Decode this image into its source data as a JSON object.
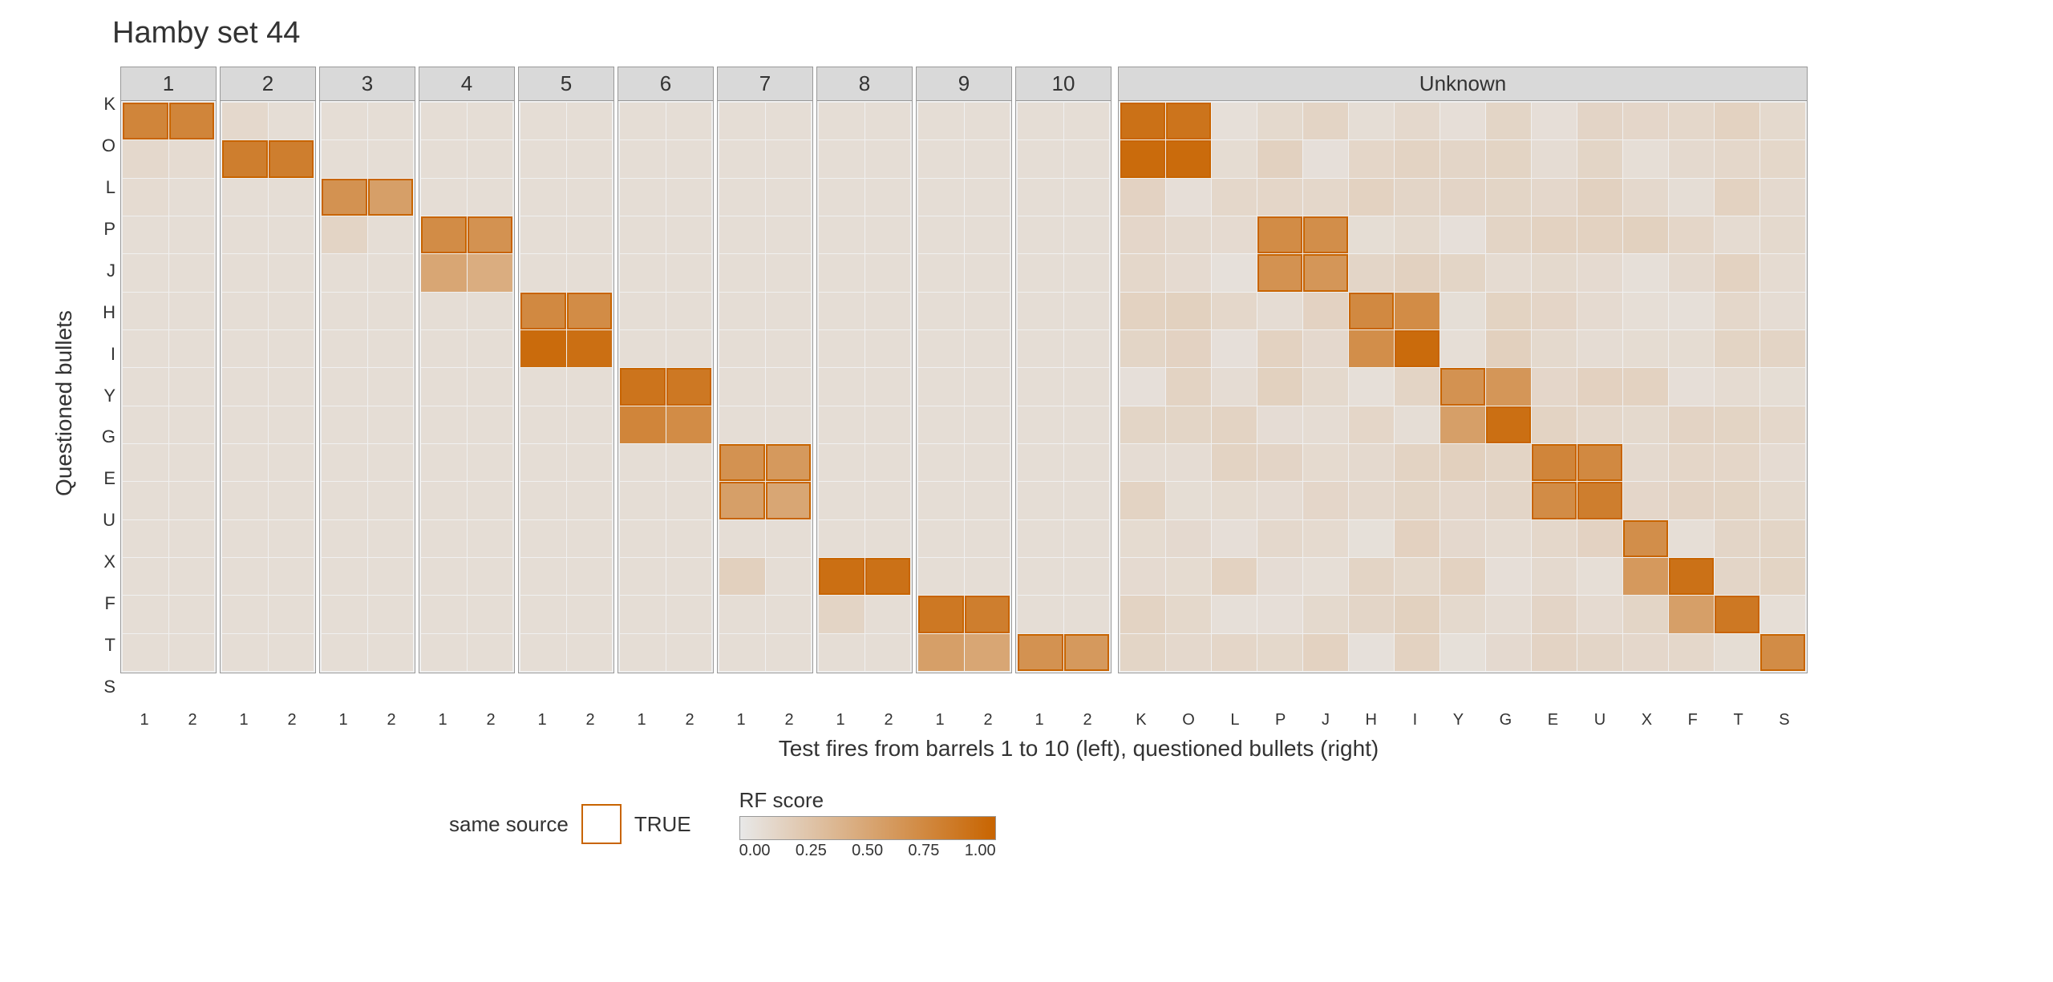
{
  "title": "Hamby set 44",
  "yAxisLabel": "Questioned bullets",
  "xAxisLabel": "Test fires from barrels 1 to 10 (left), questioned bullets (right)",
  "yLabels": [
    "K",
    "O",
    "L",
    "P",
    "J",
    "H",
    "I",
    "Y",
    "G",
    "E",
    "U",
    "X",
    "F",
    "T",
    "S"
  ],
  "barrelPanels": [
    {
      "id": "1",
      "cols": 2,
      "xTicks": [
        "1",
        "2"
      ]
    },
    {
      "id": "2",
      "cols": 2,
      "xTicks": [
        "1",
        "2"
      ]
    },
    {
      "id": "3",
      "cols": 2,
      "xTicks": [
        "1",
        "2"
      ]
    },
    {
      "id": "4",
      "cols": 2,
      "xTicks": [
        "1",
        "2"
      ]
    },
    {
      "id": "5",
      "cols": 2,
      "xTicks": [
        "1",
        "2"
      ]
    },
    {
      "id": "6",
      "cols": 2,
      "xTicks": [
        "1",
        "2"
      ]
    },
    {
      "id": "7",
      "cols": 2,
      "xTicks": [
        "1",
        "2"
      ]
    },
    {
      "id": "8",
      "cols": 2,
      "xTicks": [
        "1",
        "2"
      ]
    },
    {
      "id": "9",
      "cols": 2,
      "xTicks": [
        "1",
        "2"
      ]
    },
    {
      "id": "10",
      "cols": 2,
      "xTicks": [
        "1",
        "2"
      ]
    }
  ],
  "unknownPanel": {
    "id": "Unknown",
    "xTicks": [
      "K",
      "O",
      "L",
      "P",
      "J",
      "H",
      "I",
      "Y",
      "G",
      "E",
      "U",
      "X",
      "F",
      "T",
      "S"
    ]
  },
  "legend": {
    "sameSourceLabel": "same source",
    "trueLabel": "TRUE",
    "rfScoreLabel": "RF score",
    "rfTicks": [
      "0.00",
      "0.25",
      "0.50",
      "0.75",
      "1.00"
    ]
  },
  "colors": {
    "sameSourceBorder": "#c86400",
    "lowScore": "#e8e8e8",
    "highScore": "#c86400",
    "panelBg": "#f0f0f0",
    "panelHeader": "#d9d9d9"
  }
}
